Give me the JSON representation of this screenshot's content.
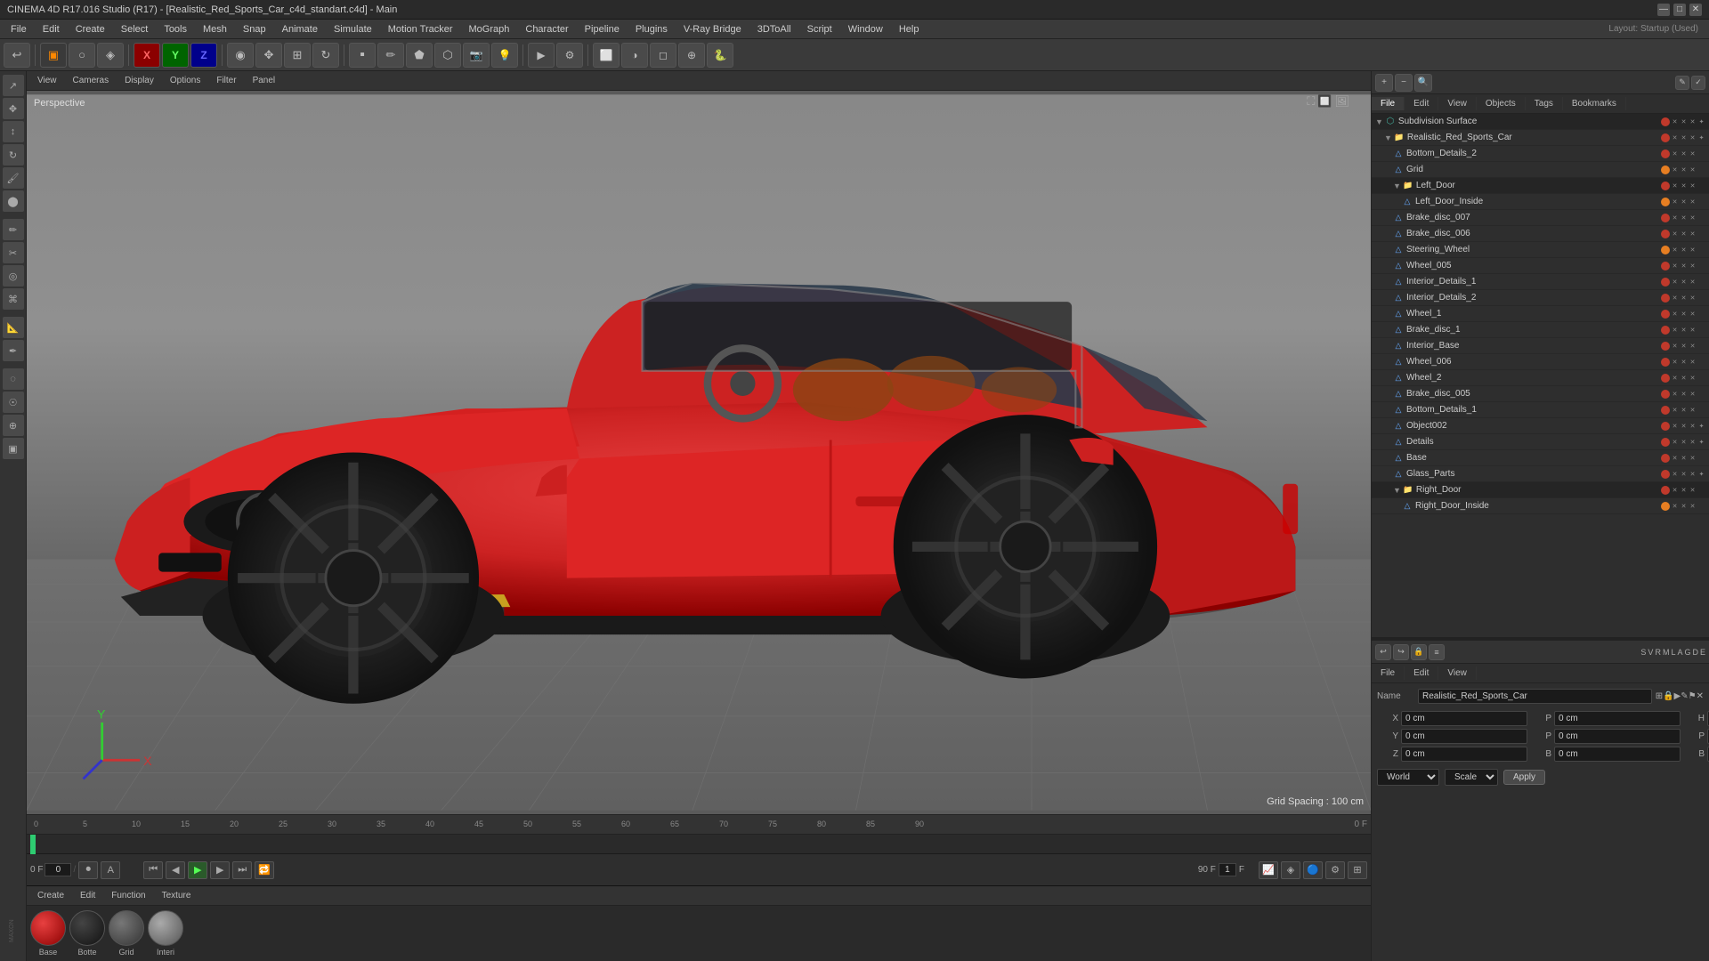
{
  "window": {
    "title": "CINEMA 4D R17.016 Studio (R17) - [Realistic_Red_Sports_Car_c4d_standart.c4d] - Main"
  },
  "titlebar": {
    "controls": [
      "—",
      "□",
      "✕"
    ]
  },
  "menubar": {
    "items": [
      "File",
      "Edit",
      "Create",
      "Select",
      "Tools",
      "Mesh",
      "Snap",
      "Animate",
      "Simulate",
      "Motion Tracker",
      "MoGraph",
      "Character",
      "Pipeline",
      "Plugins",
      "V-Ray Bridge",
      "3DToAll",
      "Script",
      "Window",
      "Help"
    ]
  },
  "layout_label": "Layout: Startup (Used)",
  "viewport": {
    "perspective_label": "Perspective",
    "grid_spacing": "Grid Spacing : 100 cm",
    "tabs": [
      "View",
      "Cameras",
      "Display",
      "Options",
      "Filter",
      "Panel"
    ]
  },
  "object_manager": {
    "tabs": [
      "File",
      "Edit",
      "View",
      "Objects",
      "Tags",
      "Bookmarks"
    ],
    "root": "Subdivision Surface",
    "objects": [
      {
        "name": "Realistic_Red_Sports_Car",
        "level": 1,
        "type": "group",
        "has_child": true
      },
      {
        "name": "Bottom_Details_2",
        "level": 2,
        "type": "mesh"
      },
      {
        "name": "Grid",
        "level": 2,
        "type": "mesh"
      },
      {
        "name": "Left_Door",
        "level": 2,
        "type": "group",
        "has_child": true
      },
      {
        "name": "Left_Door_Inside",
        "level": 3,
        "type": "mesh"
      },
      {
        "name": "Brake_disc_007",
        "level": 2,
        "type": "mesh"
      },
      {
        "name": "Brake_disc_006",
        "level": 2,
        "type": "mesh"
      },
      {
        "name": "Steering_Wheel",
        "level": 2,
        "type": "mesh"
      },
      {
        "name": "Wheel_005",
        "level": 2,
        "type": "mesh"
      },
      {
        "name": "Interior_Details_1",
        "level": 2,
        "type": "mesh"
      },
      {
        "name": "Interior_Details_2",
        "level": 2,
        "type": "mesh"
      },
      {
        "name": "Wheel_1",
        "level": 2,
        "type": "mesh"
      },
      {
        "name": "Brake_disc_1",
        "level": 2,
        "type": "mesh"
      },
      {
        "name": "Interior_Base",
        "level": 2,
        "type": "mesh"
      },
      {
        "name": "Wheel_006",
        "level": 2,
        "type": "mesh"
      },
      {
        "name": "Wheel_2",
        "level": 2,
        "type": "mesh"
      },
      {
        "name": "Brake_disc_005",
        "level": 2,
        "type": "mesh"
      },
      {
        "name": "Bottom_Details_1",
        "level": 2,
        "type": "mesh"
      },
      {
        "name": "Object002",
        "level": 2,
        "type": "mesh"
      },
      {
        "name": "Details",
        "level": 2,
        "type": "mesh"
      },
      {
        "name": "Base",
        "level": 2,
        "type": "mesh"
      },
      {
        "name": "Glass_Parts",
        "level": 2,
        "type": "mesh"
      },
      {
        "name": "Right_Door",
        "level": 2,
        "type": "group",
        "has_child": true
      },
      {
        "name": "Right_Door_Inside",
        "level": 3,
        "type": "mesh"
      }
    ]
  },
  "attributes": {
    "tabs": [
      "File",
      "Edit",
      "View"
    ],
    "name_label": "Name",
    "name_value": "Realistic_Red_Sports_Car",
    "coords": {
      "x_label": "X",
      "x_val": "0 cm",
      "x_sub": "P",
      "y_label": "Y",
      "y_val": "0 cm",
      "y_sub": "P",
      "z_label": "Z",
      "z_val": "0 cm",
      "z_sub": "B"
    },
    "world_label": "World",
    "scale_label": "Scale",
    "apply_label": "Apply"
  },
  "materials": {
    "tabs": [
      "Create",
      "Edit",
      "Function",
      "Texture"
    ],
    "items": [
      {
        "label": "Base",
        "color": "#c0392b"
      },
      {
        "label": "Botte",
        "color": "#222"
      },
      {
        "label": "Grid",
        "color": "#555"
      },
      {
        "label": "Interi",
        "color": "#888"
      }
    ]
  },
  "timeline": {
    "marks": [
      "0",
      "5",
      "10",
      "15",
      "20",
      "25",
      "30",
      "35",
      "40",
      "45",
      "50",
      "55",
      "60",
      "65",
      "70",
      "75",
      "80",
      "85",
      "90"
    ],
    "frame_label": "0 F",
    "end_frame": "90 F",
    "fps": "F",
    "current_frame": "0"
  },
  "colors": {
    "accent_blue": "#3a5a7a",
    "toolbar_bg": "#3a3a3a",
    "panel_bg": "#2e2e2e",
    "border": "#222"
  }
}
